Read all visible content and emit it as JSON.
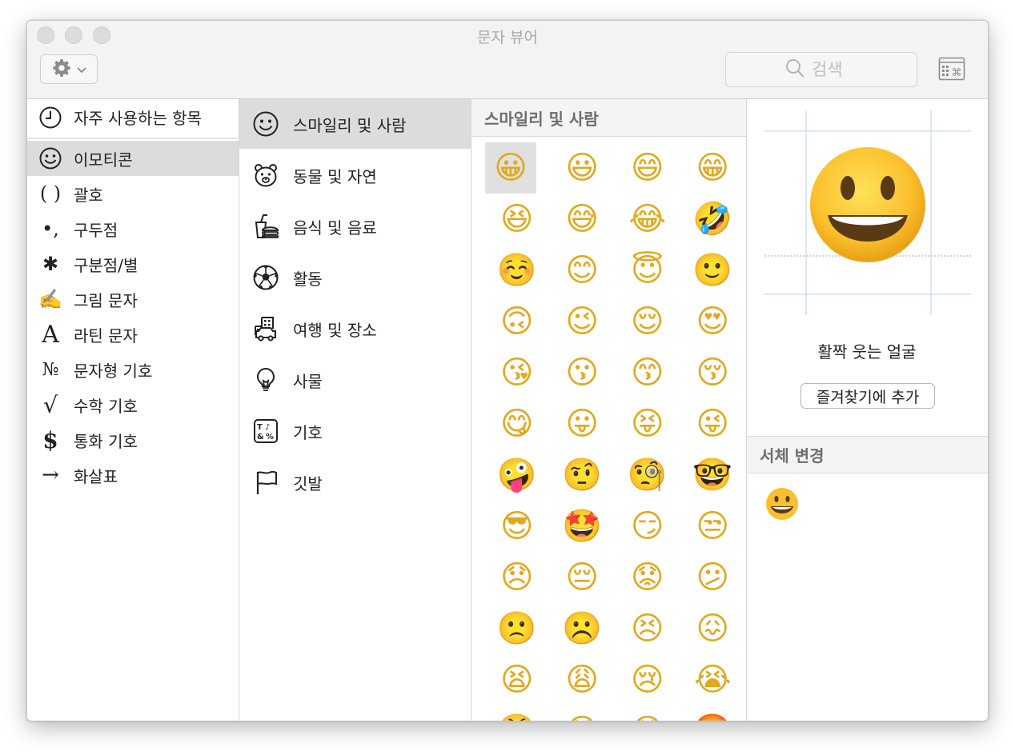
{
  "window": {
    "title": "문자 뷰어"
  },
  "toolbar": {
    "search_placeholder": "검색"
  },
  "sidebar": {
    "recent_label": "자주 사용하는 항목",
    "items": [
      {
        "label": "이모티콘",
        "icon": "smiley-icon",
        "selected": true
      },
      {
        "label": "괄호",
        "icon": "parentheses-icon",
        "glyph": "( )"
      },
      {
        "label": "구두점",
        "icon": "punctuation-icon",
        "glyph": "•,"
      },
      {
        "label": "구분점/별",
        "icon": "asterisk-icon",
        "glyph": "✱"
      },
      {
        "label": "그림 문자",
        "icon": "pictograph-hand-icon",
        "glyph": "✍"
      },
      {
        "label": "라틴 문자",
        "icon": "latin-letter-icon",
        "glyph": "A"
      },
      {
        "label": "문자형 기호",
        "icon": "numero-icon",
        "glyph": "№"
      },
      {
        "label": "수학 기호",
        "icon": "square-root-icon",
        "glyph": "√"
      },
      {
        "label": "통화 기호",
        "icon": "dollar-icon",
        "glyph": "$"
      },
      {
        "label": "화살표",
        "icon": "arrow-icon",
        "glyph": "→"
      }
    ]
  },
  "categories": {
    "items": [
      {
        "label": "스마일리 및 사람",
        "icon": "smiley-icon",
        "selected": true
      },
      {
        "label": "동물 및 자연",
        "icon": "bear-icon"
      },
      {
        "label": "음식 및 음료",
        "icon": "food-drink-icon"
      },
      {
        "label": "활동",
        "icon": "soccer-ball-icon"
      },
      {
        "label": "여행 및 장소",
        "icon": "building-car-icon"
      },
      {
        "label": "사물",
        "icon": "lightbulb-icon"
      },
      {
        "label": "기호",
        "icon": "symbols-icon"
      },
      {
        "label": "깃발",
        "icon": "flag-icon"
      }
    ]
  },
  "emoji_panel": {
    "title": "스마일리 및 사람",
    "emojis": [
      "😀",
      "😃",
      "😄",
      "😁",
      "😆",
      "😅",
      "😂",
      "🤣",
      "☺️",
      "😊",
      "😇",
      "🙂",
      "🙃",
      "😉",
      "😌",
      "😍",
      "😘",
      "😗",
      "😙",
      "😚",
      "😋",
      "😛",
      "😝",
      "😜",
      "🤪",
      "🤨",
      "🧐",
      "🤓",
      "😎",
      "🤩",
      "😏",
      "😒",
      "😞",
      "😔",
      "😟",
      "😕",
      "🙁",
      "☹️",
      "😣",
      "😖",
      "😫",
      "😩",
      "😢",
      "😭",
      "😤",
      "😠",
      "😡",
      "🤬"
    ],
    "selected_index": 0
  },
  "detail": {
    "char_name": "활짝 웃는 얼굴",
    "favorite_button": "즐겨찾기에 추가",
    "font_variation_title": "서체 변경"
  },
  "colors": {
    "emoji_face": "#FBC02D",
    "emoji_shadow": "#E8A317",
    "selection": "#DCDCDC",
    "guide_lines": "#C7D9F2"
  }
}
